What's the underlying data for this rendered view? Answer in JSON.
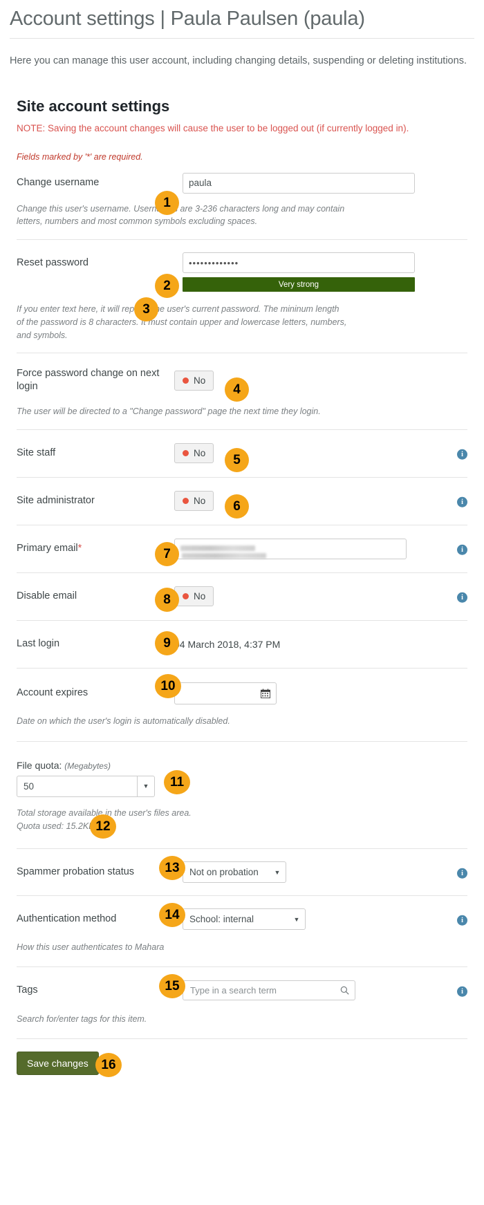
{
  "header": {
    "title": "Account settings | Paula Paulsen (paula)",
    "intro": "Here you can manage this user account, including changing details, suspending or deleting institutions."
  },
  "panel": {
    "heading": "Site account settings",
    "note": "NOTE: Saving the account changes will cause the user to be logged out (if currently logged in).",
    "required_note": "Fields marked by '*' are required."
  },
  "fields": {
    "username": {
      "label": "Change username",
      "value": "paula",
      "help": "Change this user's username. Usernames are 3-236 characters long and may contain letters, numbers and most common symbols excluding spaces."
    },
    "password": {
      "label": "Reset password",
      "value": "•••••••••••••",
      "strength": "Very strong",
      "help": "If you enter text here, it will replace the user's current password. The mininum length of the password is 8 characters. It must contain upper and lowercase letters, numbers, and symbols."
    },
    "force_password_change": {
      "label": "Force password change on next login",
      "value": "No",
      "help": "The user will be directed to a \"Change password\" page the next time they login."
    },
    "site_staff": {
      "label": "Site staff",
      "value": "No"
    },
    "site_administrator": {
      "label": "Site administrator",
      "value": "No"
    },
    "primary_email": {
      "label": "Primary email",
      "required_marker": "*",
      "value": ""
    },
    "disable_email": {
      "label": "Disable email",
      "value": "No"
    },
    "last_login": {
      "label": "Last login",
      "value": "04 March 2018, 4:37 PM"
    },
    "account_expires": {
      "label": "Account expires",
      "value": "",
      "help": "Date on which the user's login is automatically disabled."
    },
    "file_quota": {
      "label": "File quota:",
      "unit": "(Megabytes)",
      "value": "50",
      "help": "Total storage available in the user's files area.",
      "quota_used": "Quota used: 15.2KB"
    },
    "spammer_probation": {
      "label": "Spammer probation status",
      "value": "Not on probation"
    },
    "authentication_method": {
      "label": "Authentication method",
      "value": "School: internal",
      "help": "How this user authenticates to Mahara"
    },
    "tags": {
      "label": "Tags",
      "placeholder": "Type in a search term",
      "value": "",
      "help": "Search for/enter tags for this item."
    }
  },
  "actions": {
    "save": "Save changes"
  },
  "badges": {
    "b1": "1",
    "b2": "2",
    "b3": "3",
    "b4": "4",
    "b5": "5",
    "b6": "6",
    "b7": "7",
    "b8": "8",
    "b9": "9",
    "b10": "10",
    "b11": "11",
    "b12": "12",
    "b13": "13",
    "b14": "14",
    "b15": "15",
    "b16": "16"
  },
  "colors": {
    "accent_badge": "#f5a619",
    "note_red": "#d9534f",
    "strength_green": "#35620a",
    "save_green": "#556b2b",
    "info_blue": "#4a87ab",
    "toggle_dot_red": "#e9553f"
  }
}
